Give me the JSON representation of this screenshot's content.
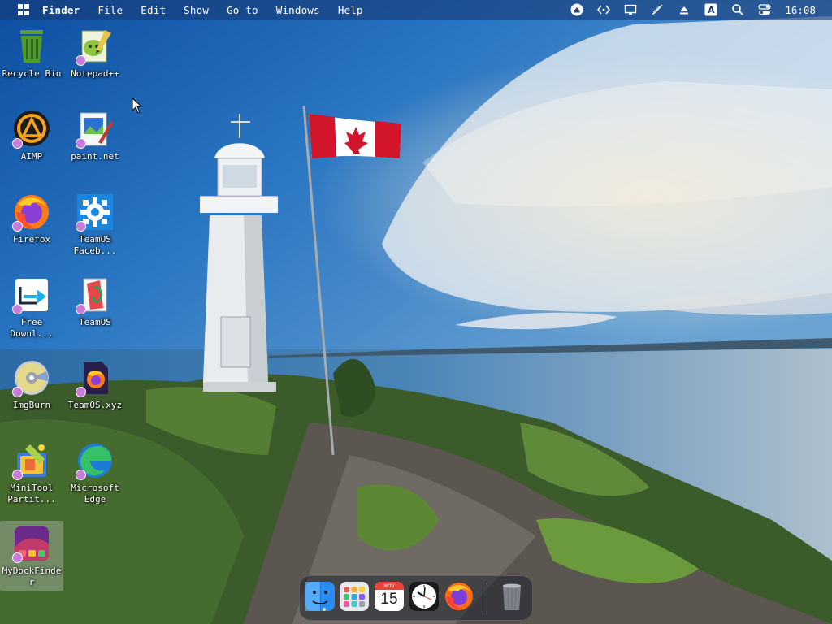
{
  "menubar": {
    "app_name": "Finder",
    "items": [
      "File",
      "Edit",
      "Show",
      "Go to",
      "Windows",
      "Help"
    ],
    "status_icons": [
      "eject-icon",
      "code-brackets-icon",
      "display-icon",
      "pen-off-icon",
      "upload-icon",
      "input-source-icon",
      "search-icon",
      "control-center-icon"
    ],
    "input_source": "A",
    "clock": "16:08"
  },
  "desktop_icons": [
    {
      "label": "Recycle Bin",
      "icon": "recycle-bin-icon"
    },
    {
      "label": "Notepad++",
      "icon": "notepad-plus-plus-icon"
    },
    {
      "label": "AIMP",
      "icon": "aimp-icon"
    },
    {
      "label": "paint.net",
      "icon": "paint-net-icon"
    },
    {
      "label": "Firefox",
      "icon": "firefox-icon"
    },
    {
      "label": "TeamOS Faceb...",
      "icon": "gear-icon"
    },
    {
      "label": "Free Downl...",
      "icon": "free-download-manager-icon"
    },
    {
      "label": "TeamOS",
      "icon": "teamos-icon"
    },
    {
      "label": "ImgBurn",
      "icon": "imgburn-icon"
    },
    {
      "label": "TeamOS.xyz",
      "icon": "firefox-doc-icon"
    },
    {
      "label": "MiniTool Partit...",
      "icon": "minitool-icon"
    },
    {
      "label": "Microsoft Edge",
      "icon": "edge-icon"
    },
    {
      "label": "MyDockFinder",
      "icon": "mydockfinder-icon"
    }
  ],
  "dock": {
    "calendar_month": "NOV",
    "calendar_day": "15",
    "items": [
      "finder-icon",
      "launchpad-icon",
      "calendar-icon",
      "clock-icon",
      "firefox-icon",
      "trash-icon"
    ]
  },
  "colors": {
    "menubar_bg": "#183a78",
    "shortcut_badge": "#c77dd8"
  }
}
